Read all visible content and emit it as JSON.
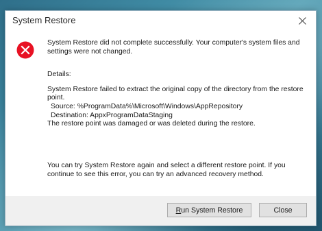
{
  "desktop": {
    "background_color": "#3f8aa3"
  },
  "dialog": {
    "title": "System Restore",
    "close_icon": "close-icon",
    "error_icon": "error-icon",
    "error_color": "#e81123",
    "message": "System Restore did not complete successfully. Your computer's system files and settings were not changed.",
    "details_label": "Details:",
    "details_line1": "System Restore failed to extract the original copy of the directory from the restore point.",
    "details_source": "Source: %ProgramData%\\Microsoft\\Windows\\AppRepository",
    "details_destination": "Destination: AppxProgramDataStaging",
    "details_line4": "The restore point was damaged or was deleted during the restore.",
    "footer_message": "You can try System Restore again and select a different restore point. If you continue to see this error, you can try an advanced recovery method.",
    "buttons": {
      "run_mnemonic": "R",
      "run_rest": "un System Restore",
      "close_label": "Close"
    }
  }
}
